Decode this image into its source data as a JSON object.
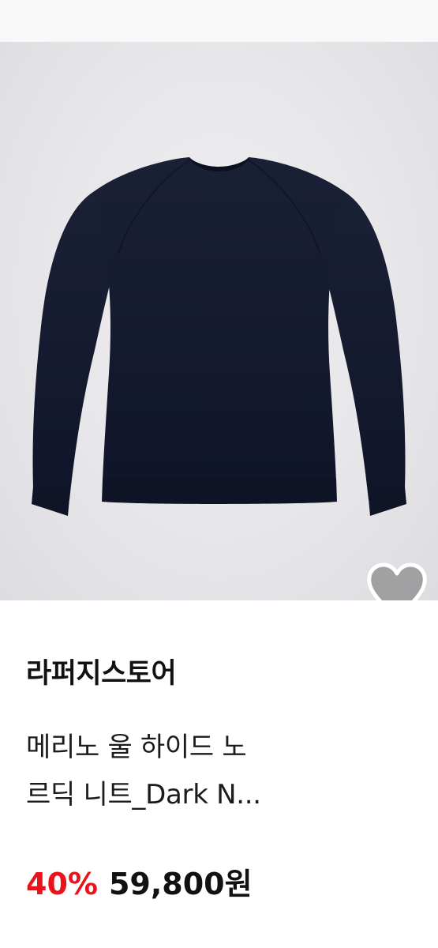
{
  "product": {
    "store_name": "라퍼지스토어",
    "name_line1": "메리노 울 하이드 노",
    "name_line2": "르딕 니트_Dark N...",
    "discount": "40%",
    "price": "59,800원",
    "image_description": "navy crewneck sweater on light gray background",
    "wishlisted": false
  },
  "colors": {
    "discount": "#e8131b",
    "text": "#111111",
    "image_background": "#e7e6e9",
    "sweater": "#141a2b"
  },
  "icons": {
    "wish": "heart-icon"
  }
}
